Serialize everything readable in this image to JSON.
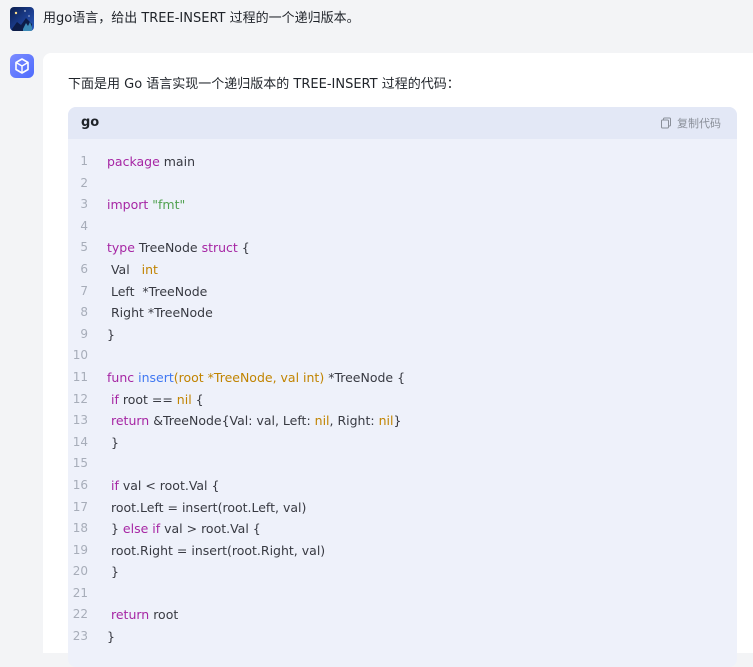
{
  "user_message": {
    "text": "用go语言，给出 TREE-INSERT 过程的一个递归版本。"
  },
  "answer": {
    "intro": "下面是用 Go 语言实现一个递归版本的 TREE-INSERT 过程的代码："
  },
  "code_block": {
    "language": "go",
    "copy_label": "复制代码",
    "lines": [
      {
        "num": "1",
        "segments": [
          {
            "t": "package",
            "c": "kw"
          },
          {
            "t": " main",
            "c": ""
          }
        ]
      },
      {
        "num": "2",
        "segments": []
      },
      {
        "num": "3",
        "segments": [
          {
            "t": "import",
            "c": "kw"
          },
          {
            "t": " ",
            "c": ""
          },
          {
            "t": "\"fmt\"",
            "c": "st"
          }
        ]
      },
      {
        "num": "4",
        "segments": []
      },
      {
        "num": "5",
        "segments": [
          {
            "t": "type",
            "c": "kw"
          },
          {
            "t": " TreeNode ",
            "c": ""
          },
          {
            "t": "struct",
            "c": "kw"
          },
          {
            "t": " {",
            "c": ""
          }
        ]
      },
      {
        "num": "6",
        "segments": [
          {
            "t": " Val   ",
            "c": ""
          },
          {
            "t": "int",
            "c": "ty"
          }
        ]
      },
      {
        "num": "7",
        "segments": [
          {
            "t": " Left  *TreeNode",
            "c": ""
          }
        ]
      },
      {
        "num": "8",
        "segments": [
          {
            "t": " Right *TreeNode",
            "c": ""
          }
        ]
      },
      {
        "num": "9",
        "segments": [
          {
            "t": "}",
            "c": ""
          }
        ]
      },
      {
        "num": "10",
        "segments": []
      },
      {
        "num": "11",
        "segments": [
          {
            "t": "func",
            "c": "kw"
          },
          {
            "t": " ",
            "c": ""
          },
          {
            "t": "insert",
            "c": "fn"
          },
          {
            "t": "(root *TreeNode, val ",
            "c": "ty"
          },
          {
            "t": "int",
            "c": "ty"
          },
          {
            "t": ")",
            "c": "ty"
          },
          {
            "t": " *TreeNode {",
            "c": ""
          }
        ]
      },
      {
        "num": "12",
        "segments": [
          {
            "t": " ",
            "c": ""
          },
          {
            "t": "if",
            "c": "kw"
          },
          {
            "t": " root == ",
            "c": ""
          },
          {
            "t": "nil",
            "c": "nl"
          },
          {
            "t": " {",
            "c": ""
          }
        ]
      },
      {
        "num": "13",
        "segments": [
          {
            "t": " ",
            "c": ""
          },
          {
            "t": "return",
            "c": "kw"
          },
          {
            "t": " &TreeNode{Val: val, Left: ",
            "c": ""
          },
          {
            "t": "nil",
            "c": "nl"
          },
          {
            "t": ", Right: ",
            "c": ""
          },
          {
            "t": "nil",
            "c": "nl"
          },
          {
            "t": "}",
            "c": ""
          }
        ]
      },
      {
        "num": "14",
        "segments": [
          {
            "t": " }",
            "c": ""
          }
        ]
      },
      {
        "num": "15",
        "segments": []
      },
      {
        "num": "16",
        "segments": [
          {
            "t": " ",
            "c": ""
          },
          {
            "t": "if",
            "c": "kw"
          },
          {
            "t": " val < root.Val {",
            "c": ""
          }
        ]
      },
      {
        "num": "17",
        "segments": [
          {
            "t": " root.Left = insert(root.Left, val)",
            "c": ""
          }
        ]
      },
      {
        "num": "18",
        "segments": [
          {
            "t": " } ",
            "c": ""
          },
          {
            "t": "else",
            "c": "kw"
          },
          {
            "t": " ",
            "c": ""
          },
          {
            "t": "if",
            "c": "kw"
          },
          {
            "t": " val > root.Val {",
            "c": ""
          }
        ]
      },
      {
        "num": "19",
        "segments": [
          {
            "t": " root.Right = insert(root.Right, val)",
            "c": ""
          }
        ]
      },
      {
        "num": "20",
        "segments": [
          {
            "t": " }",
            "c": ""
          }
        ]
      },
      {
        "num": "21",
        "segments": []
      },
      {
        "num": "22",
        "segments": [
          {
            "t": " ",
            "c": ""
          },
          {
            "t": "return",
            "c": "kw"
          },
          {
            "t": " root",
            "c": ""
          }
        ]
      },
      {
        "num": "23",
        "segments": [
          {
            "t": "}",
            "c": ""
          }
        ]
      }
    ]
  },
  "colors": {
    "page_background": "#f3f4f6",
    "code_background": "#eef1fa",
    "code_header_background": "#e3e8f6",
    "keyword": "#a626a4",
    "string": "#50a14f",
    "type": "#c18401",
    "function": "#4078f2",
    "line_number": "#a7adb9"
  },
  "icons": {
    "user_avatar": "user-avatar",
    "bot_avatar": "cube-icon",
    "copy": "copy-icon"
  }
}
